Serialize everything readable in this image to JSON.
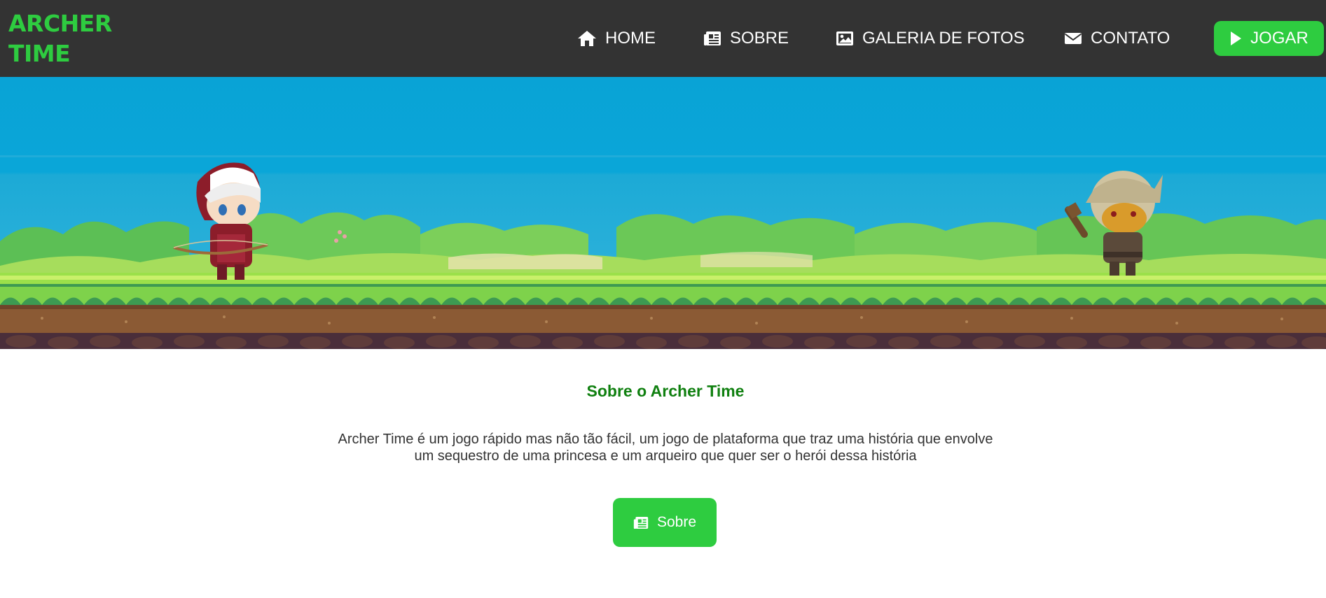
{
  "brand": {
    "line1": "ARCHER",
    "line2": "TIME",
    "color": "#2ecc40"
  },
  "nav": {
    "items": [
      {
        "label": "HOME",
        "icon": "home-icon"
      },
      {
        "label": "SOBRE",
        "icon": "newspaper-icon"
      },
      {
        "label": "GALERIA DE FOTOS",
        "icon": "image-icon"
      },
      {
        "label": "CONTATO",
        "icon": "envelope-icon"
      }
    ],
    "play": {
      "label": "JOGAR",
      "icon": "play-icon"
    }
  },
  "about": {
    "title": "Sobre o Archer Time",
    "text": "Archer Time é um jogo rápido mas não tão fácil, um jogo de plataforma que traz uma história que envolve um sequestro de uma princesa e um arqueiro que quer ser o herói dessa história",
    "button": {
      "label": "Sobre",
      "icon": "newspaper-icon"
    }
  },
  "colors": {
    "navbar_bg": "#333333",
    "accent_green": "#2ecc40",
    "title_green": "#108010",
    "sky": "#1fa9d4"
  }
}
